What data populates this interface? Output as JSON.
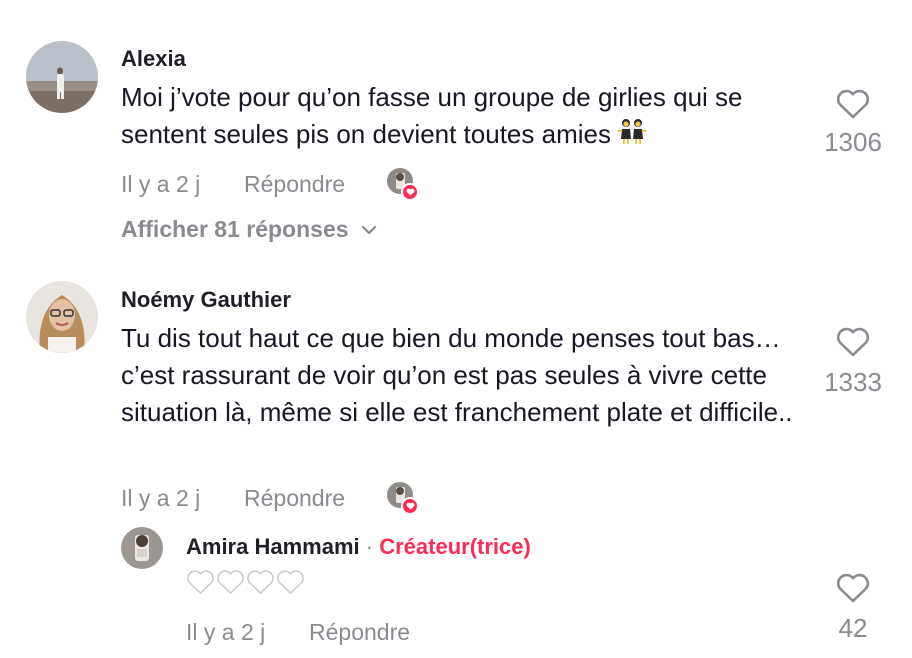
{
  "comments": [
    {
      "username": "Alexia",
      "text": "Moi j’vote pour qu’on fasse un groupe de girlies qui se sentent seules pis on devient toutes amies",
      "emoji_name": "two-women-dancing-emoji",
      "time": "Il y a 2 j",
      "reply": "Répondre",
      "likes": "1306",
      "view_replies": "Afficher 81 réponses"
    },
    {
      "username": "Noémy Gauthier",
      "text": "Tu dis tout haut ce que bien du monde penses tout bas… c’est rassurant de voir qu’on est pas seules à vivre cette situation là, même si elle est franchement plate et difficile..",
      "time": "Il y a 2 j",
      "reply": "Répondre",
      "likes": "1333"
    }
  ],
  "creator_reply": {
    "username": "Amira Hammami",
    "separator": "·",
    "badge": "Créateur(trice)",
    "text_emoji_names": [
      "white-heart-emoji",
      "white-heart-emoji",
      "white-heart-emoji",
      "white-heart-emoji"
    ],
    "time": "Il y a 2 j",
    "reply": "Répondre",
    "likes": "42"
  },
  "colors": {
    "text": "#161823",
    "secondary": "#8a8b91",
    "creator_accent": "#fe2c55"
  }
}
